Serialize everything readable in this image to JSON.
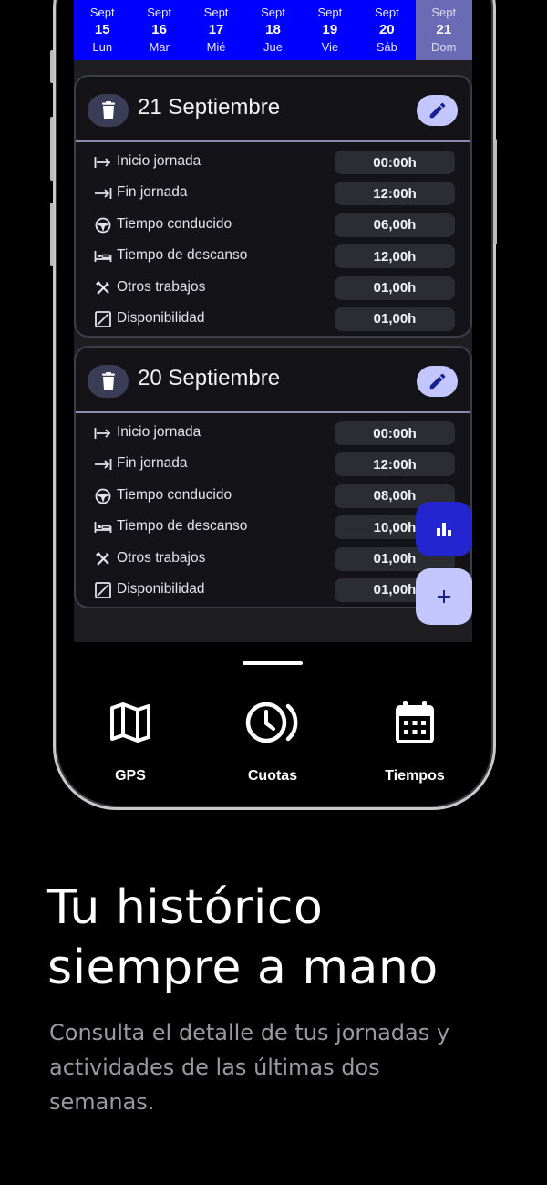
{
  "days": [
    {
      "month": "Sept",
      "num": "15",
      "weekday": "Lun",
      "active": false
    },
    {
      "month": "Sept",
      "num": "16",
      "weekday": "Mar",
      "active": false
    },
    {
      "month": "Sept",
      "num": "17",
      "weekday": "Mié",
      "active": false
    },
    {
      "month": "Sept",
      "num": "18",
      "weekday": "Jue",
      "active": false
    },
    {
      "month": "Sept",
      "num": "19",
      "weekday": "Vie",
      "active": false
    },
    {
      "month": "Sept",
      "num": "20",
      "weekday": "Sáb",
      "active": false
    },
    {
      "month": "Sept",
      "num": "21",
      "weekday": "Dom",
      "active": true
    }
  ],
  "cards": [
    {
      "title": "21 Septiembre",
      "rows": [
        {
          "icon": "arrow-to-bar-icon",
          "label": "Inicio jornada",
          "value": "00:00h"
        },
        {
          "icon": "arrow-end-icon",
          "label": "Fin jornada",
          "value": "12:00h"
        },
        {
          "icon": "steering-wheel-icon",
          "label": "Tiempo conducido",
          "value": "06,00h"
        },
        {
          "icon": "bed-icon",
          "label": "Tiempo de descanso",
          "value": "12,00h"
        },
        {
          "icon": "tools-icon",
          "label": "Otros trabajos",
          "value": "01,00h"
        },
        {
          "icon": "availability-icon",
          "label": "Disponibilidad",
          "value": "01,00h"
        }
      ]
    },
    {
      "title": "20 Septiembre",
      "rows": [
        {
          "icon": "arrow-to-bar-icon",
          "label": "Inicio jornada",
          "value": "00:00h"
        },
        {
          "icon": "arrow-end-icon",
          "label": "Fin jornada",
          "value": "12:00h"
        },
        {
          "icon": "steering-wheel-icon",
          "label": "Tiempo conducido",
          "value": "08,00h"
        },
        {
          "icon": "bed-icon",
          "label": "Tiempo de descanso",
          "value": "10,00h"
        },
        {
          "icon": "tools-icon",
          "label": "Otros trabajos",
          "value": "01,00h"
        },
        {
          "icon": "availability-icon",
          "label": "Disponibilidad",
          "value": "01,00h"
        }
      ]
    }
  ],
  "nav": [
    {
      "label": "GPS",
      "icon": "map-icon"
    },
    {
      "label": "Cuotas",
      "icon": "clock-icon"
    },
    {
      "label": "Tiempos",
      "icon": "calendar-icon"
    }
  ],
  "headline": {
    "line1": "Tu histórico",
    "line2": "siempre a mano"
  },
  "subtext": {
    "line1": "Consulta el detalle de tus jornadas y",
    "line2": "actividades de las últimas dos",
    "line3": "semanas."
  },
  "colors": {
    "day_strip": "#0000ff",
    "fab_stats": "#2326d0",
    "fab_add": "#c4c7ff"
  }
}
